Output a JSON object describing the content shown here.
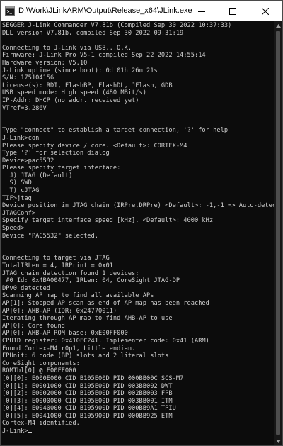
{
  "window": {
    "title": "D:\\Work\\JLinkARM\\Output\\Release_x64\\JLink.exe",
    "app_icon": "console-app-icon",
    "controls": {
      "minimize_icon": "minimize-icon",
      "maximize_icon": "maximize-icon",
      "close_icon": "close-icon"
    }
  },
  "colors": {
    "console_background": "#0c0c0c",
    "console_text": "#cccccc",
    "titlebar_background": "#ffffff",
    "scrollbar_track": "#171717",
    "scrollbar_thumb": "#4d4d4d"
  },
  "console": {
    "lines": [
      "SEGGER J-Link Commander V7.81b (Compiled Sep 30 2022 10:37:33)",
      "DLL version V7.81b, compiled Sep 30 2022 09:31:19",
      "",
      "Connecting to J-Link via USB...O.K.",
      "Firmware: J-Link Pro V5-1 compiled Sep 22 2022 14:55:14",
      "Hardware version: V5.10",
      "J-Link uptime (since boot): 0d 01h 26m 21s",
      "S/N: 175104156",
      "License(s): RDI, FlashBP, FlashDL, JFlash, GDB",
      "USB speed mode: High speed (480 MBit/s)",
      "IP-Addr: DHCP (no addr. received yet)",
      "VTref=3.286V",
      "",
      "",
      "Type \"connect\" to establish a target connection, '?' for help",
      "J-Link>con",
      "Please specify device / core. <Default>: CORTEX-M4",
      "Type '?' for selection dialog",
      "Device>pac5532",
      "Please specify target interface:",
      "  J) JTAG (Default)",
      "  S) SWD",
      "  T) cJTAG",
      "TIF>jtag",
      "Device position in JTAG chain (IRPre,DRPre) <Default>: -1,-1 => Auto-detect",
      "JTAGConf>",
      "Specify target interface speed [kHz]. <Default>: 4000 kHz",
      "Speed>",
      "Device \"PAC5532\" selected.",
      "",
      "",
      "Connecting to target via JTAG",
      "TotalIRLen = 4, IRPrint = 0x01",
      "JTAG chain detection found 1 devices:",
      " #0 Id: 0x4BA00477, IRLen: 04, CoreSight JTAG-DP",
      "DPv0 detected",
      "Scanning AP map to find all available APs",
      "AP[1]: Stopped AP scan as end of AP map has been reached",
      "AP[0]: AHB-AP (IDR: 0x24770011)",
      "Iterating through AP map to find AHB-AP to use",
      "AP[0]: Core found",
      "AP[0]: AHB-AP ROM base: 0xE00FF000",
      "CPUID register: 0x410FC241. Implementer code: 0x41 (ARM)",
      "Found Cortex-M4 r0p1, Little endian.",
      "FPUnit: 6 code (BP) slots and 2 literal slots",
      "CoreSight components:",
      "ROMTbl[0] @ E00FF000",
      "[0][0]: E000E000 CID B105E00D PID 000BB00C SCS-M7",
      "[0][1]: E0001000 CID B105E00D PID 003BB002 DWT",
      "[0][2]: E0002000 CID B105E00D PID 002BB003 FPB",
      "[0][3]: E0000000 CID B105E00D PID 003BB001 ITM",
      "[0][4]: E0040000 CID B105900D PID 000BB9A1 TPIU",
      "[0][5]: E0041000 CID B105900D PID 000BB925 ETM",
      "Cortex-M4 identified."
    ],
    "prompt": "J-Link>"
  },
  "scrollbar": {
    "up_icon": "scroll-up-arrow-icon",
    "down_icon": "scroll-down-arrow-icon"
  }
}
